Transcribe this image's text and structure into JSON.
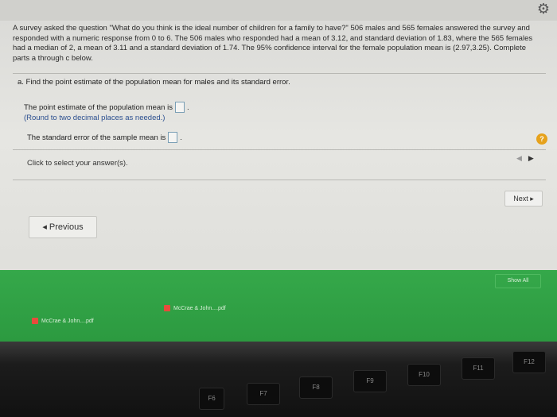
{
  "question": {
    "text": "A survey asked the question \"What do you think is the ideal number of children for a family to have?\" 506 males and 565 females answered the survey and responded with a numeric response from 0 to 6. The 506 males who responded had a mean of 3.12, and standard deviation of 1.83, where the 565 females had a median of 2, a mean of 3.11 and a standard deviation of 1.74. The 95% confidence interval for the female population mean is (2.97,3.25). Complete parts a through c below."
  },
  "part_a": {
    "label": "a. Find the point estimate of the population mean for males and its standard error.",
    "point_estimate_label": "The point estimate of the population mean is",
    "point_estimate_suffix": ".",
    "rounding_hint": "(Round to two decimal places as needed.)",
    "std_error_label": "The standard error of the sample mean is",
    "std_error_suffix": "."
  },
  "footer": {
    "click_hint": "Click to select your answer(s).",
    "help_label": "?",
    "next_label": "Next ▸",
    "previous_label": "◂ Previous"
  },
  "nav_arrows": {
    "left": "◀",
    "right": "▶"
  },
  "gear_icon": "⚙",
  "downloads": {
    "items": [
      "McCrae & John....pdf",
      "McCrae & John....pdf"
    ],
    "show_all": "Show All"
  },
  "keyboard": {
    "keys": [
      "F6",
      "F7",
      "F8",
      "F9",
      "F10",
      "F11",
      "F12"
    ]
  },
  "colors": {
    "accent_green": "#35a84a",
    "help_orange": "#e6a21c",
    "hint_blue": "#2b4f8f"
  }
}
